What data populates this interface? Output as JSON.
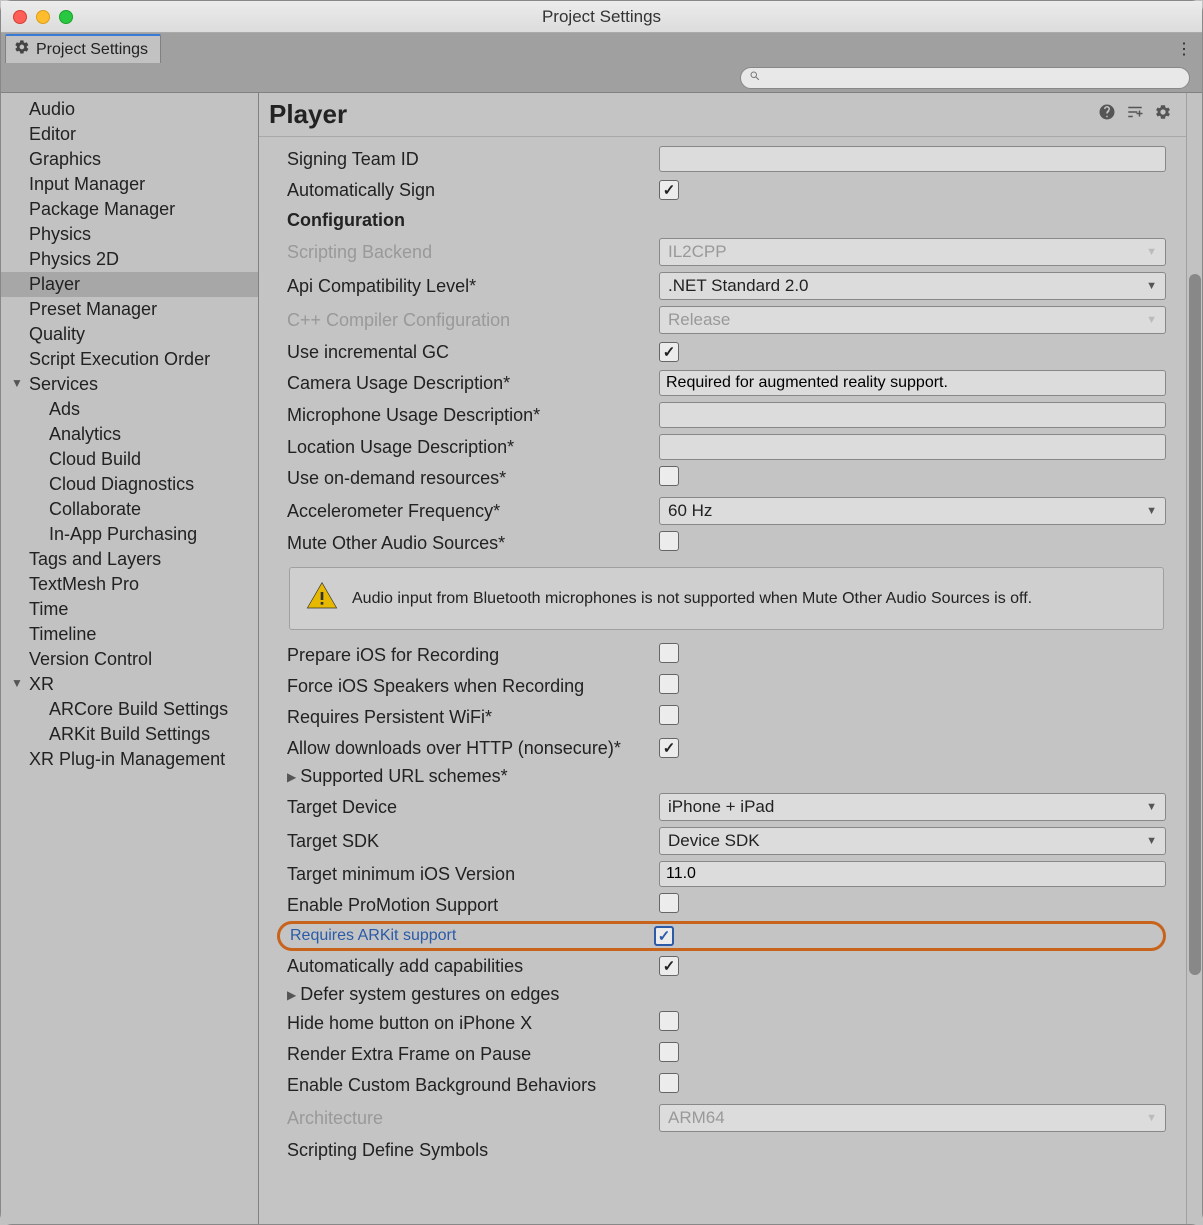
{
  "window": {
    "title": "Project Settings"
  },
  "tab": {
    "label": "Project Settings"
  },
  "search": {
    "placeholder": ""
  },
  "sidebar": {
    "items": [
      {
        "label": "Audio"
      },
      {
        "label": "Editor"
      },
      {
        "label": "Graphics"
      },
      {
        "label": "Input Manager"
      },
      {
        "label": "Package Manager"
      },
      {
        "label": "Physics"
      },
      {
        "label": "Physics 2D"
      },
      {
        "label": "Player",
        "selected": true
      },
      {
        "label": "Preset Manager"
      },
      {
        "label": "Quality"
      },
      {
        "label": "Script Execution Order"
      },
      {
        "label": "Services",
        "arrow": true
      },
      {
        "label": "Ads",
        "child": true
      },
      {
        "label": "Analytics",
        "child": true
      },
      {
        "label": "Cloud Build",
        "child": true
      },
      {
        "label": "Cloud Diagnostics",
        "child": true
      },
      {
        "label": "Collaborate",
        "child": true
      },
      {
        "label": "In-App Purchasing",
        "child": true
      },
      {
        "label": "Tags and Layers"
      },
      {
        "label": "TextMesh Pro"
      },
      {
        "label": "Time"
      },
      {
        "label": "Timeline"
      },
      {
        "label": "Version Control"
      },
      {
        "label": "XR",
        "arrow": true
      },
      {
        "label": "ARCore Build Settings",
        "child": true
      },
      {
        "label": "ARKit Build Settings",
        "child": true
      },
      {
        "label": "XR Plug-in Management"
      }
    ]
  },
  "main": {
    "title": "Player",
    "signing_team_id_label": "Signing Team ID",
    "signing_team_id_value": "",
    "auto_sign_label": "Automatically Sign",
    "config_header": "Configuration",
    "scripting_backend_label": "Scripting Backend",
    "scripting_backend_value": "IL2CPP",
    "api_compat_label": "Api Compatibility Level*",
    "api_compat_value": ".NET Standard 2.0",
    "cpp_compiler_label": "C++ Compiler Configuration",
    "cpp_compiler_value": "Release",
    "incremental_gc_label": "Use incremental GC",
    "camera_usage_label": "Camera Usage Description*",
    "camera_usage_value": "Required for augmented reality support.",
    "mic_usage_label": "Microphone Usage Description*",
    "mic_usage_value": "",
    "location_usage_label": "Location Usage Description*",
    "location_usage_value": "",
    "ondemand_label": "Use on-demand resources*",
    "accel_freq_label": "Accelerometer Frequency*",
    "accel_freq_value": "60 Hz",
    "mute_audio_label": "Mute Other Audio Sources*",
    "warning_text": "Audio input from Bluetooth microphones is not supported when Mute Other Audio Sources is off.",
    "prepare_ios_label": "Prepare iOS for Recording",
    "force_ios_speakers_label": "Force iOS Speakers when Recording",
    "persistent_wifi_label": "Requires Persistent WiFi*",
    "allow_http_label": "Allow downloads over HTTP (nonsecure)*",
    "url_schemes_label": "Supported URL schemes*",
    "target_device_label": "Target Device",
    "target_device_value": "iPhone + iPad",
    "target_sdk_label": "Target SDK",
    "target_sdk_value": "Device SDK",
    "min_ios_label": "Target minimum iOS Version",
    "min_ios_value": "11.0",
    "promotion_label": "Enable ProMotion Support",
    "arkit_label": "Requires ARKit support",
    "auto_capabilities_label": "Automatically add capabilities",
    "defer_gestures_label": "Defer system gestures on edges",
    "hide_home_label": "Hide home button on iPhone X",
    "render_extra_label": "Render Extra Frame on Pause",
    "custom_bg_label": "Enable Custom Background Behaviors",
    "architecture_label": "Architecture",
    "architecture_value": "ARM64",
    "scripting_define_label": "Scripting Define Symbols"
  }
}
